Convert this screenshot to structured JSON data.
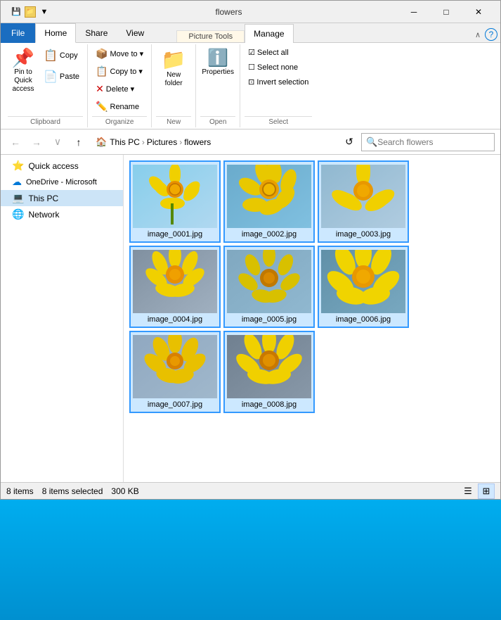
{
  "window": {
    "title": "flowers",
    "folder_path": "flowers"
  },
  "titlebar": {
    "title": "flowers",
    "minimize": "─",
    "maximize": "□",
    "close": "✕"
  },
  "quickaccess": {
    "pin_label": "Pin to Quick access",
    "copy_label": "Copy"
  },
  "ribbon": {
    "tabs": [
      {
        "id": "file",
        "label": "File"
      },
      {
        "id": "home",
        "label": "Home"
      },
      {
        "id": "share",
        "label": "Share"
      },
      {
        "id": "view",
        "label": "View"
      },
      {
        "id": "manage",
        "label": "Manage"
      },
      {
        "id": "picture_tools_header",
        "label": "Picture Tools"
      }
    ],
    "clipboard": {
      "label": "Clipboard",
      "pin_label": "Pin to Quick\naccess",
      "copy_label": "Copy",
      "paste_label": "Paste"
    },
    "organize": {
      "label": "Organize",
      "move_to": "Move to",
      "copy_to": "Copy to",
      "delete": "Delete",
      "rename": "Rename"
    },
    "new_group": {
      "label": "New",
      "new_folder": "New\nfolder"
    },
    "open_group": {
      "label": "Open",
      "properties": "Properties"
    },
    "select": {
      "label": "Select",
      "select_all": "Select all",
      "select_none": "Select none",
      "invert": "Invert selection"
    }
  },
  "navbar": {
    "back": "←",
    "forward": "→",
    "recent": "∨",
    "up": "↑",
    "breadcrumb": [
      "This PC",
      "Pictures",
      "flowers"
    ],
    "search_placeholder": "Search flowers"
  },
  "sidebar": {
    "items": [
      {
        "id": "quick-access",
        "label": "Quick access",
        "icon": "⭐"
      },
      {
        "id": "onedrive",
        "label": "OneDrive - Microsoft",
        "icon": "☁"
      },
      {
        "id": "this-pc",
        "label": "This PC",
        "icon": "💻",
        "selected": true
      },
      {
        "id": "network",
        "label": "Network",
        "icon": "🌐"
      }
    ]
  },
  "files": [
    {
      "id": 1,
      "name": "image_0001.jpg",
      "color1": "#87ceeb",
      "color2": "#b0d0e8"
    },
    {
      "id": 2,
      "name": "image_0002.jpg",
      "color1": "#6aabcc",
      "color2": "#80c0e0"
    },
    {
      "id": 3,
      "name": "image_0003.jpg",
      "color1": "#90b8d0",
      "color2": "#aaccdf"
    },
    {
      "id": 4,
      "name": "image_0004.jpg",
      "color1": "#8090a8",
      "color2": "#9aa8b8"
    },
    {
      "id": 5,
      "name": "image_0005.jpg",
      "color1": "#80a8c0",
      "color2": "#90b8d0"
    },
    {
      "id": 6,
      "name": "image_0006.jpg",
      "color1": "#6090a8",
      "color2": "#78a8c0"
    },
    {
      "id": 7,
      "name": "image_0007.jpg",
      "color1": "#90a8c0",
      "color2": "#a0b8cc"
    },
    {
      "id": 8,
      "name": "image_0008.jpg",
      "color1": "#708090",
      "color2": "#8898a8"
    }
  ],
  "statusbar": {
    "item_count": "8 items",
    "selected_count": "8 items selected",
    "size": "300 KB"
  }
}
